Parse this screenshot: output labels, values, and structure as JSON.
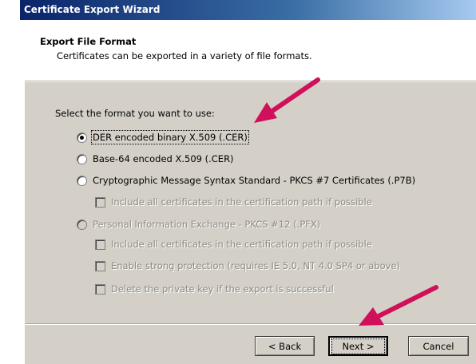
{
  "window": {
    "title": "Certificate Export Wizard"
  },
  "header": {
    "title": "Export File Format",
    "subtitle": "Certificates can be exported in a variety of file formats."
  },
  "body": {
    "prompt": "Select the format you want to use:",
    "options": [
      {
        "label": "DER encoded binary X.509 (.CER)",
        "selected": true,
        "enabled": true
      },
      {
        "label": "Base-64 encoded X.509 (.CER)",
        "selected": false,
        "enabled": true
      },
      {
        "label": "Cryptographic Message Syntax Standard - PKCS #7 Certificates (.P7B)",
        "selected": false,
        "enabled": true
      },
      {
        "label": "Personal Information Exchange - PKCS #12 (.PFX)",
        "selected": false,
        "enabled": false
      }
    ],
    "checkboxes": [
      {
        "label": "Include all certificates in the certification path if possible",
        "checked": false,
        "enabled": false
      },
      {
        "label": "Include all certificates in the certification path if possible",
        "checked": false,
        "enabled": false
      },
      {
        "label": "Enable strong protection (requires IE 5.0, NT 4.0 SP4 or above)",
        "checked": false,
        "enabled": false
      },
      {
        "label": "Delete the private key if the export is successful",
        "checked": false,
        "enabled": false
      }
    ]
  },
  "buttons": {
    "back": "< Back",
    "next": "Next >",
    "cancel": "Cancel"
  },
  "annotation": {
    "arrow_color": "#d0105a"
  }
}
